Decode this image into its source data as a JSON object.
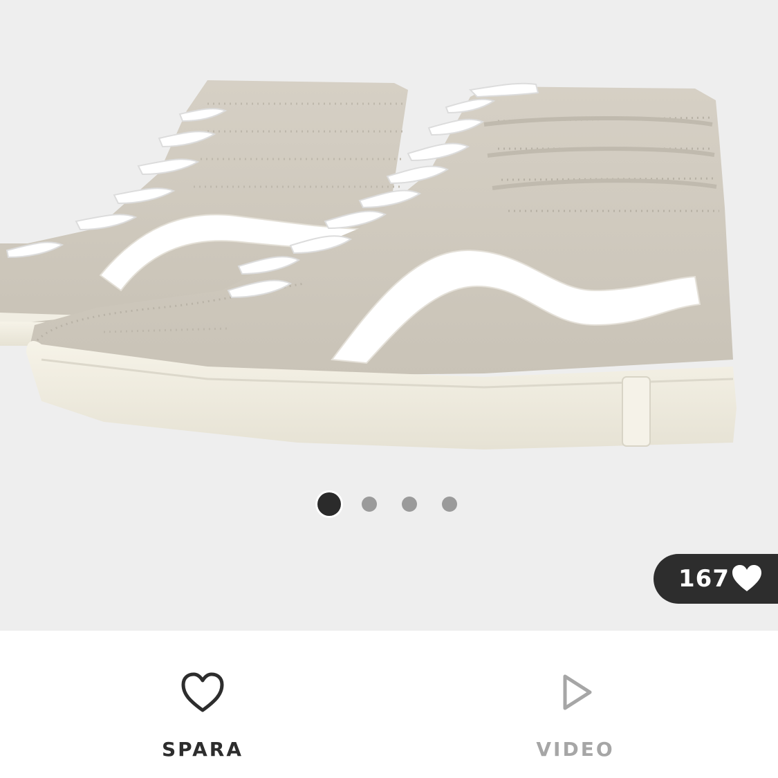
{
  "gallery": {
    "image_icon": "high-top-sneaker-image",
    "dots": {
      "count": 4,
      "active_index": 0
    },
    "likes": {
      "count": "167",
      "icon": "heart-icon"
    }
  },
  "actions": {
    "save": {
      "label": "SPARA",
      "icon": "heart-outline-icon"
    },
    "video": {
      "label": "VIDEO",
      "icon": "play-icon"
    }
  },
  "colors": {
    "background": "#eeeeee",
    "suede": "#cfc9bd",
    "sole": "#f3f0e4",
    "dark": "#2d2d2d",
    "muted": "#a6a6a6"
  }
}
